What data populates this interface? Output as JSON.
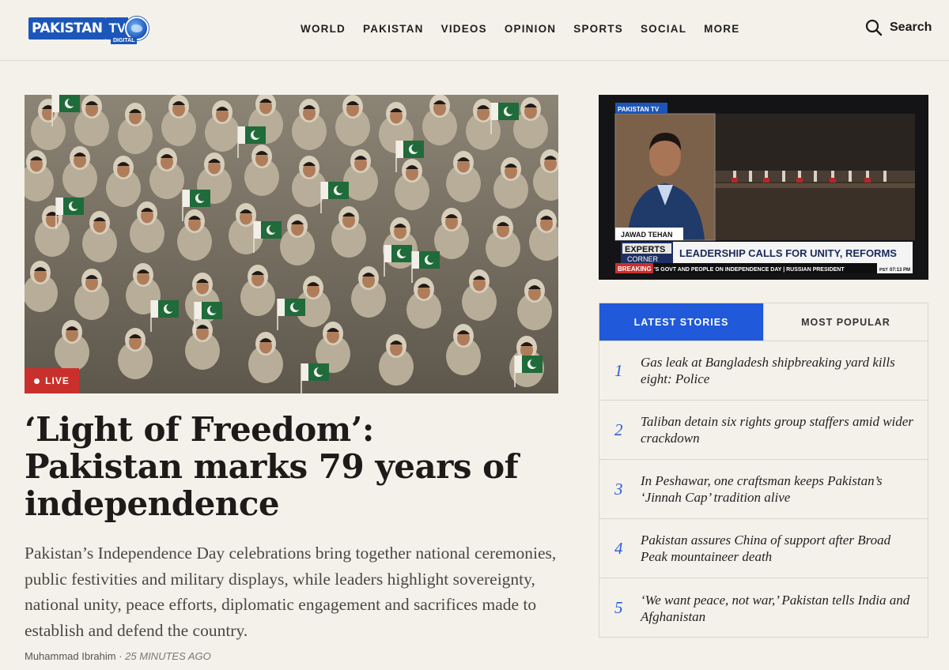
{
  "header": {
    "logo_text": "PAKISTAN",
    "logo_tv": "TV",
    "logo_sub": "DIGITAL",
    "nav": [
      "WORLD",
      "PAKISTAN",
      "VIDEOS",
      "OPINION",
      "SPORTS",
      "SOCIAL",
      "MORE"
    ],
    "search_label": "Search"
  },
  "hero": {
    "badge": "LIVE",
    "headline": "‘Light of Freedom’: Pakistan marks 79 years of independence",
    "summary": "Pakistan’s Independence Day celebrations bring together national ceremonies, public festivities and military displays, while leaders highlight sovereignty, national unity, peace efforts, diplomatic engagement and sacrifices made to establish and defend the country.",
    "author": "Muhammad Ibrahim",
    "separator": " · ",
    "time": "25 MINUTES AGO"
  },
  "video": {
    "channel": "PAKISTAN TV",
    "speaker": "JAWAD TEHAN",
    "show_top": "EXPERTS",
    "show_bottom": "CORNER",
    "headline": "LEADERSHIP CALLS FOR UNITY, REFORMS",
    "breaking_label": "BREAKING",
    "ticker": "'S GOVT AND PEOPLE ON INDEPENDENCE DAY  |  RUSSIAN PRESIDENT",
    "time_zone": "PST",
    "time": "07:13 PM"
  },
  "stories": {
    "tabs": [
      "LATEST STORIES",
      "MOST POPULAR"
    ],
    "items": [
      {
        "num": "1",
        "title": "Gas leak at Bangladesh shipbreaking yard kills eight: Police"
      },
      {
        "num": "2",
        "title": "Taliban detain six rights group staffers amid wider crackdown"
      },
      {
        "num": "3",
        "title": "In Peshawar, one craftsman keeps Pakistan’s ‘Jinnah Cap’ tradition alive"
      },
      {
        "num": "4",
        "title": "Pakistan assures China of support after Broad Peak mountaineer death"
      },
      {
        "num": "5",
        "title": "‘We want peace, not war,’ Pakistan tells India and Afghanistan"
      }
    ]
  },
  "colors": {
    "accent": "#2059d9",
    "live": "#c9302c",
    "background": "#f4f1ea",
    "flag_green": "#1f6b3a"
  }
}
